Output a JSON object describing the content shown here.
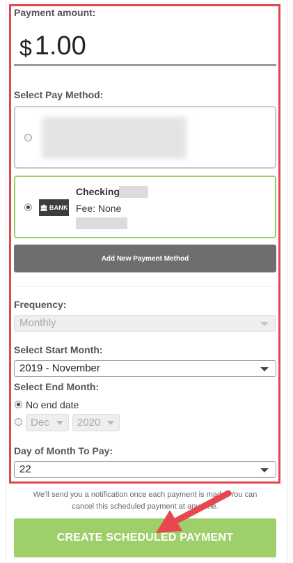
{
  "payment": {
    "amount_label": "Payment amount:",
    "currency_symbol": "$",
    "amount_value": "1.00"
  },
  "pay_method": {
    "label": "Select Pay Method:",
    "methods": [
      {
        "selected": false,
        "name": "",
        "fee": ""
      },
      {
        "selected": true,
        "logo_text": "BANK",
        "name": "Checking",
        "fee": "Fee: None"
      }
    ],
    "add_button": "Add New Payment Method"
  },
  "frequency": {
    "label": "Frequency:",
    "value": "Monthly",
    "disabled": true
  },
  "start_month": {
    "label": "Select Start Month:",
    "value": "2019 - November"
  },
  "end_month": {
    "label": "Select End Month:",
    "no_end_label": "No end date",
    "no_end_selected": true,
    "month_value": "Dec",
    "year_value": "2020"
  },
  "day_of_month": {
    "label": "Day of Month To Pay:",
    "value": "22"
  },
  "notice": {
    "line1": "We'll send you a notification once each payment is made. You can",
    "line2": "cancel this scheduled payment at any time."
  },
  "create_button": "CREATE SCHEDULED PAYMENT",
  "colors": {
    "highlight": "#e0474f",
    "selected_border": "#9ccc6a",
    "create_button": "#9fcf6a",
    "add_button": "#6e6e6e",
    "arrow": "#e8474f"
  }
}
